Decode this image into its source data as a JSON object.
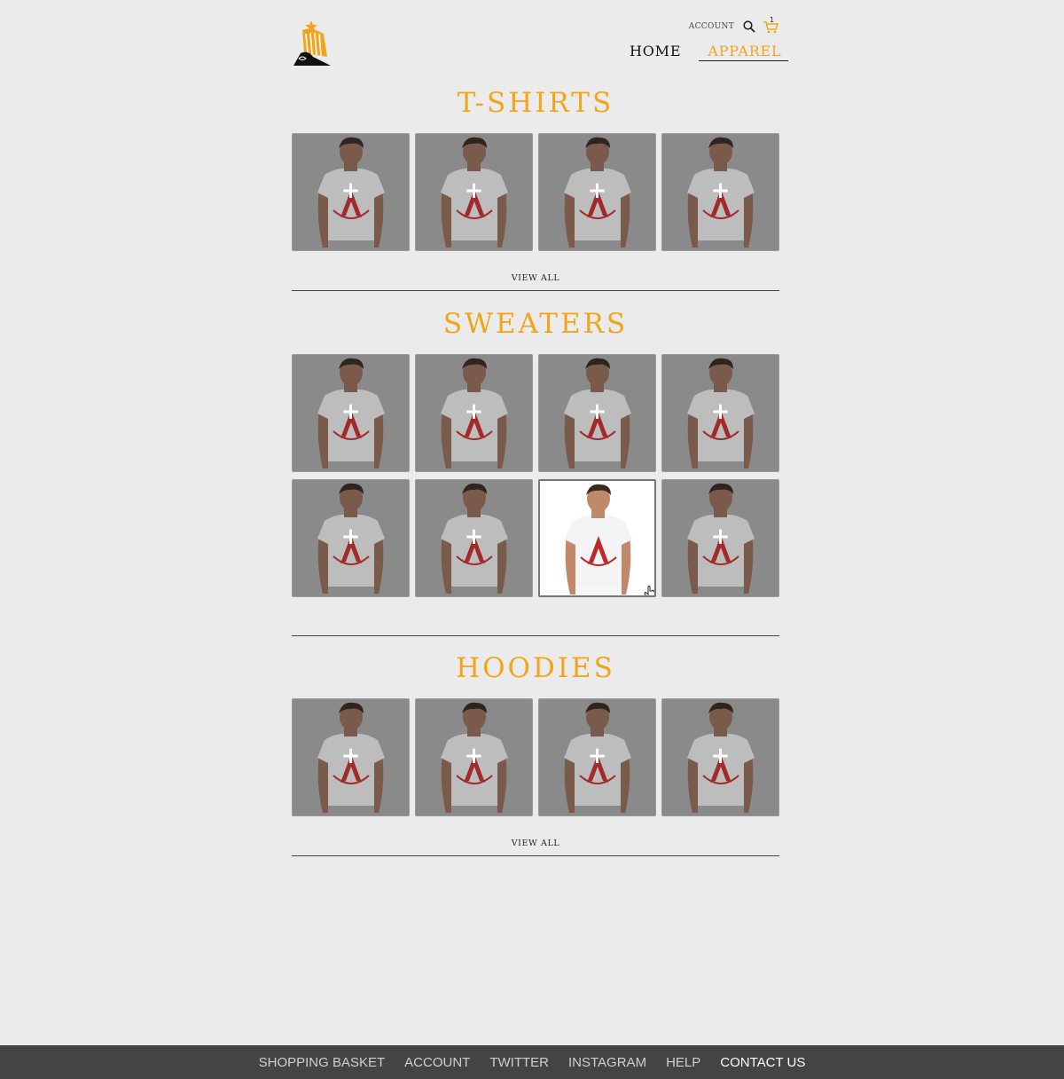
{
  "header": {
    "account_label": "ACCOUNT",
    "cart_count": "1",
    "nav": [
      {
        "label": "HOME",
        "active": false
      },
      {
        "label": "APPAREL",
        "active": true
      }
    ]
  },
  "sections": {
    "tshirts": {
      "title": "T-SHIRTS",
      "view_all": "VIEW ALL"
    },
    "sweaters": {
      "title": "SWEATERS"
    },
    "hoodies": {
      "title": "HOODIES",
      "view_all": "VIEW ALL"
    }
  },
  "tile_plus": "+",
  "footer": {
    "links": [
      "SHOPPING BASKET",
      "ACCOUNT",
      "TWITTER",
      "INSTAGRAM",
      "HELP",
      "CONTACT US"
    ]
  },
  "colors": {
    "accent": "#f2a51c",
    "footer_bg": "#444444",
    "page_bg": "#ebebeb"
  }
}
